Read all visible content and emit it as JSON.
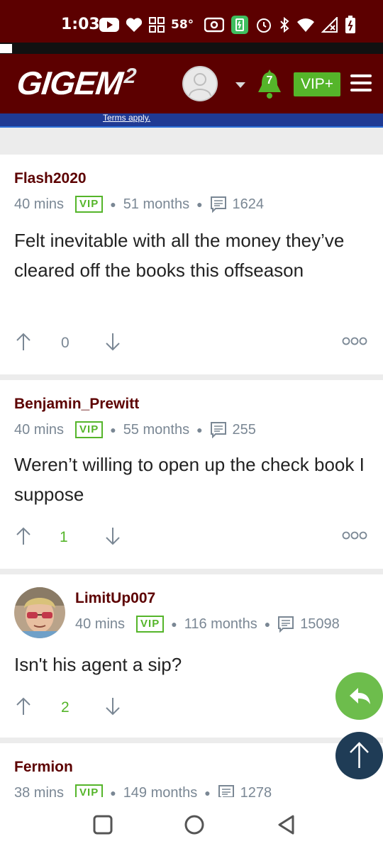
{
  "status_bar": {
    "time": "1:03",
    "temperature": "58°"
  },
  "header": {
    "logo": "GIGEM",
    "logo_sup": "2",
    "notification_count": "7",
    "vip_label": "VIP+"
  },
  "promo": {
    "terms": "Terms apply."
  },
  "comments": [
    {
      "user": "Flash2020",
      "time": "40 mins",
      "badge": "VIP",
      "tenure": "51 months",
      "posts": "1624",
      "body": "Felt inevitable with all the money they’ve cleared off the books this offseason",
      "votes": "0"
    },
    {
      "user": "Benjamin_Prewitt",
      "time": "40 mins",
      "badge": "VIP",
      "tenure": "55 months",
      "posts": "255",
      "body": "Weren’t willing to open up the check book I suppose",
      "votes": "1"
    },
    {
      "user": "LimitUp007",
      "time": "40 mins",
      "badge": "VIP",
      "tenure": "116 months",
      "posts": "15098",
      "body": "Isn't his agent a sip?",
      "votes": "2"
    },
    {
      "user": "Fermion",
      "time": "38 mins",
      "badge": "VIP",
      "tenure": "149 months",
      "posts": "1278"
    }
  ],
  "colors": {
    "maroon": "#5c0000",
    "green": "#55b52a",
    "meta_gray": "#7a8794",
    "fab_top": "#1f3c56",
    "fab_reply": "#6dbd4c"
  },
  "icons": [
    "youtube-icon",
    "heart-icon",
    "grid-icon",
    "radio-icon",
    "battery-saver-icon",
    "alarm-icon",
    "bluetooth-icon",
    "wifi-icon",
    "no-signal-icon",
    "battery-icon",
    "bell-icon",
    "menu-icon",
    "comment-icon",
    "upvote-icon",
    "downvote-icon",
    "more-icon",
    "reply-icon",
    "arrow-up-icon",
    "square-nav-icon",
    "circle-nav-icon",
    "back-nav-icon"
  ]
}
